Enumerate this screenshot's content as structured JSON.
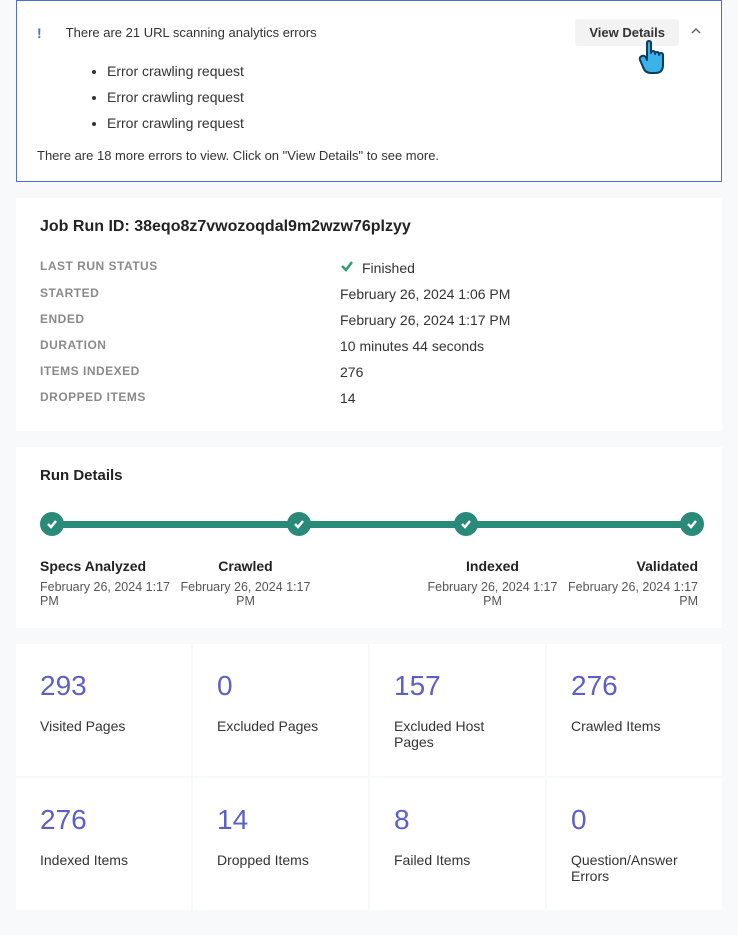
{
  "alert": {
    "title": "There are 21 URL scanning analytics errors",
    "view_details_label": "View Details",
    "errors": [
      "Error crawling request",
      "Error crawling request",
      "Error crawling request"
    ],
    "footer": "There are 18 more errors to view. Click on \"View Details\" to see more."
  },
  "job": {
    "title_prefix": "Job Run ID: ",
    "id": "38eqo8z7vwozoqdal9m2wzw76plzyy",
    "rows": [
      {
        "label": "LAST RUN STATUS",
        "value": "Finished",
        "hasCheck": true
      },
      {
        "label": "STARTED",
        "value": "February 26, 2024 1:06 PM"
      },
      {
        "label": "ENDED",
        "value": "February 26, 2024 1:17 PM"
      },
      {
        "label": "DURATION",
        "value": "10 minutes 44 seconds"
      },
      {
        "label": "ITEMS INDEXED",
        "value": "276"
      },
      {
        "label": "DROPPED ITEMS",
        "value": "14"
      }
    ]
  },
  "run_details": {
    "title": "Run Details",
    "steps": [
      {
        "label": "Specs Analyzed",
        "date": "February 26, 2024 1:17 PM"
      },
      {
        "label": "Crawled",
        "date": "February 26, 2024 1:17 PM"
      },
      {
        "label": "Indexed",
        "date": "February 26, 2024 1:17 PM"
      },
      {
        "label": "Validated",
        "date": "February 26, 2024 1:17 PM"
      }
    ]
  },
  "stats": [
    {
      "value": "293",
      "label": "Visited Pages"
    },
    {
      "value": "0",
      "label": "Excluded Pages"
    },
    {
      "value": "157",
      "label": "Excluded Host Pages"
    },
    {
      "value": "276",
      "label": "Crawled Items"
    },
    {
      "value": "276",
      "label": "Indexed Items"
    },
    {
      "value": "14",
      "label": "Dropped Items"
    },
    {
      "value": "8",
      "label": "Failed Items"
    },
    {
      "value": "0",
      "label": "Question/Answer Errors"
    }
  ]
}
